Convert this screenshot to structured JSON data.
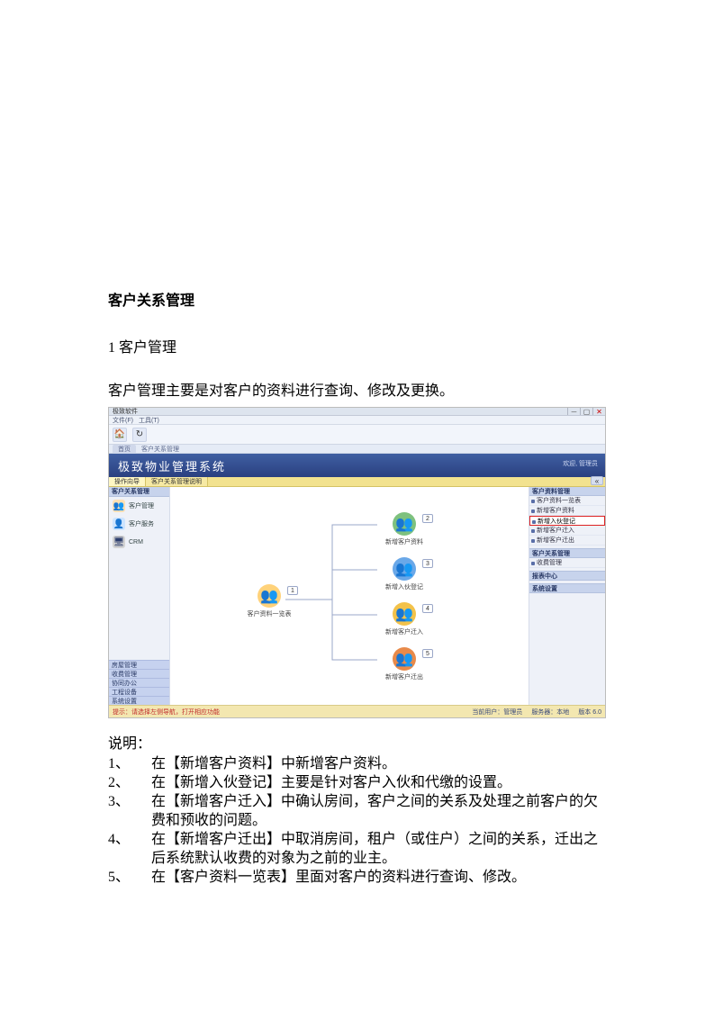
{
  "doc": {
    "heading": "客户关系管理",
    "section_num": "1 客户管理",
    "intro": "客户管理主要是对客户的资料进行查询、修改及更换。",
    "explain_title": "说明：",
    "items": [
      {
        "num": "1、",
        "text": "在【新增客户资料】中新增客户资料。"
      },
      {
        "num": "2、",
        "text": "在【新增入伙登记】主要是针对客户入伙和代缴的设置。"
      },
      {
        "num": "3、",
        "text": "在【新增客户迁入】中确认房间，客户之间的关系及处理之前客户的欠费和预收的问题。"
      },
      {
        "num": "4、",
        "text": "在【新增客户迁出】中取消房间，租户（或住户）之间的关系，迁出之后系统默认收费的对象为之前的业主。"
      },
      {
        "num": "5、",
        "text": "在【客户资料一览表】里面对客户的资料进行查询、修改。"
      }
    ]
  },
  "app": {
    "titlebar": "极致软件",
    "menubar": [
      "文件(F)",
      "工具(T)"
    ],
    "crumb": {
      "home": "首页",
      "path": "客户关系管理"
    },
    "banner_title": "极致物业管理系统",
    "welcome": "欢迎, 管理员",
    "tabs": [
      "操作向导",
      "客户关系管理说明"
    ],
    "left_head": "客户关系管理",
    "left_items": [
      {
        "icon": "👥",
        "cls": "ico-users",
        "label": "客户管理"
      },
      {
        "icon": "👤",
        "cls": "ico-person",
        "label": "客户服务"
      },
      {
        "icon": "🖥",
        "cls": "ico-pc",
        "label": "CRM"
      }
    ],
    "left_bottom": [
      "房屋管理",
      "收费管理",
      "协同办公",
      "工程设备",
      "系统设置"
    ],
    "root_node": {
      "label": "客户资料一览表",
      "badge": "1"
    },
    "child_nodes": [
      {
        "label": "新增客户资料",
        "badge": "2",
        "color": "#7ec17e"
      },
      {
        "label": "新增入伙登记",
        "badge": "3",
        "color": "#6aa8e8"
      },
      {
        "label": "新增客户迁入",
        "badge": "4",
        "color": "#f3c24a"
      },
      {
        "label": "新增客户迁出",
        "badge": "5",
        "color": "#e88a4a"
      }
    ],
    "right": {
      "head": "客户资料管理",
      "group1": [
        "客户资料一览表",
        "新增客户资料",
        "新增入伙登记",
        "新增客户迁入",
        "新增客户迁出"
      ],
      "highlight_index": 2,
      "sections": [
        {
          "title": "客户关系管理",
          "items": [
            "收费管理"
          ]
        },
        {
          "title": "报表中心",
          "items": []
        },
        {
          "title": "系统设置",
          "items": []
        }
      ]
    },
    "right_close": "«",
    "status_left": "提示：请选择左侧导航，打开相应功能",
    "status_right": [
      "当前用户：管理员",
      "服务器：本地",
      "版本 6.0"
    ]
  }
}
